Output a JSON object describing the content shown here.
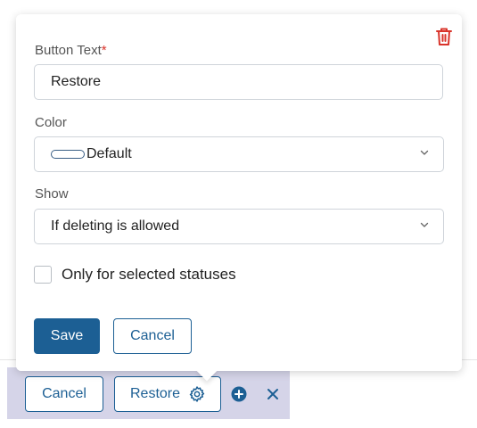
{
  "form": {
    "button_text_label": "Button Text",
    "required_mark": "*",
    "button_text_value": "Restore",
    "color_label": "Color",
    "color_value": "Default",
    "show_label": "Show",
    "show_value": "If deleting is allowed",
    "status_checkbox_label": "Only for selected statuses",
    "status_checkbox_checked": false
  },
  "actions": {
    "save_label": "Save",
    "cancel_label": "Cancel"
  },
  "toolbar": {
    "cancel_label": "Cancel",
    "restore_label": "Restore"
  },
  "icons": {
    "delete": "trash-icon",
    "settings": "gear-icon",
    "add": "plus-circle-icon",
    "close": "close-icon",
    "dropdown": "chevron-down-icon"
  },
  "colors": {
    "primary": "#1c5f94",
    "danger": "#d9342b",
    "toolbar_bg": "#d5d4e8"
  }
}
